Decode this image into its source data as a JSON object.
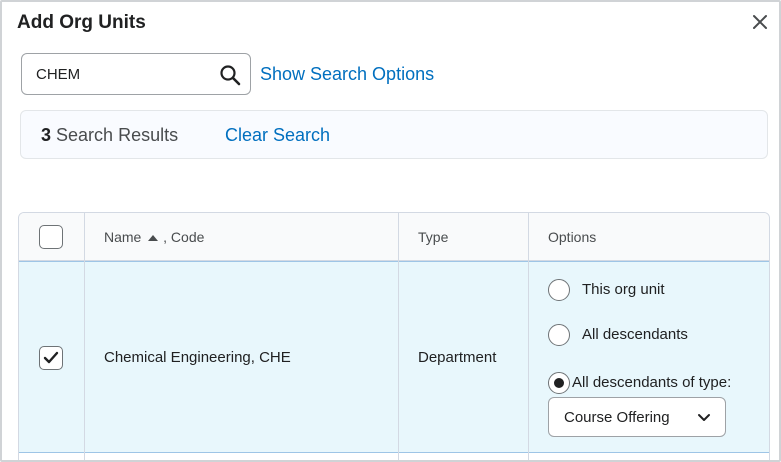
{
  "dialog": {
    "title": "Add Org Units",
    "close_icon": "close-icon"
  },
  "search": {
    "value": "CHEM",
    "placeholder": "",
    "icon": "search-icon",
    "show_options_label": "Show Search Options"
  },
  "results": {
    "count": "3",
    "label": "Search Results",
    "clear_label": "Clear Search"
  },
  "table": {
    "headers": {
      "name": "Name",
      "name_sort_icon": "sort-ascending-icon",
      "code": ", Code",
      "type": "Type",
      "options": "Options"
    },
    "rows": [
      {
        "selected": true,
        "name": "Chemical Engineering, CHE",
        "type": "Department",
        "options": {
          "radio_this": "This org unit",
          "radio_all": "All descendants",
          "radio_type": "All descendants of type:",
          "selected_option": "All descendants of type:",
          "descendant_type": "Course Offering"
        }
      }
    ]
  },
  "colors": {
    "link": "#006fbf",
    "selected_row_bg": "#e8f7fc",
    "selected_row_border": "#9ec5e6",
    "border": "#d3d9e3"
  }
}
